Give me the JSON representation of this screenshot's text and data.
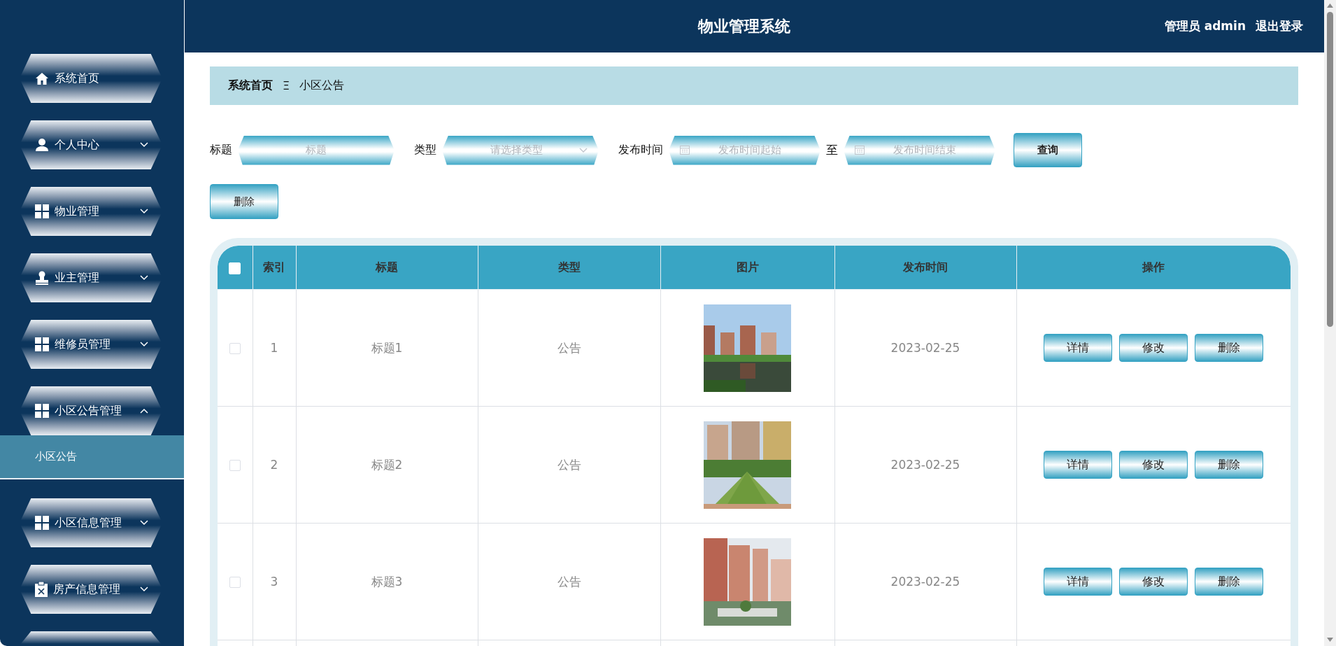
{
  "header": {
    "title": "物业管理系统",
    "user": "管理员 admin",
    "logout": "退出登录"
  },
  "sidebar": {
    "items": [
      {
        "label": "系统首页",
        "kind": "link"
      },
      {
        "label": "个人中心",
        "kind": "menu",
        "expanded": false
      },
      {
        "label": "物业管理",
        "kind": "menu",
        "expanded": false
      },
      {
        "label": "业主管理",
        "kind": "menu",
        "expanded": false
      },
      {
        "label": "维修员管理",
        "kind": "menu",
        "expanded": false
      },
      {
        "label": "小区公告管理",
        "kind": "menu",
        "expanded": true,
        "children": [
          {
            "label": "小区公告",
            "selected": true
          }
        ]
      },
      {
        "label": "小区信息管理",
        "kind": "menu",
        "expanded": false
      },
      {
        "label": "房产信息管理",
        "kind": "menu",
        "expanded": false
      }
    ]
  },
  "breadcrumb": {
    "items": [
      "系统首页",
      "小区公告"
    ],
    "separator": "Ξ"
  },
  "filters": [
    {
      "kind": "text",
      "label": "标题",
      "placeholder": "标题"
    },
    {
      "kind": "select",
      "label": "类型",
      "placeholder": "请选择类型"
    },
    {
      "kind": "daterange",
      "label": "发布时间",
      "placeholder": "发布时间起始",
      "to": "至",
      "placeholder_end": "发布时间结束"
    }
  ],
  "search_button": "查询",
  "delete_button": "删除",
  "table": {
    "select_all": {
      "checked": false
    },
    "columns": [
      "索引",
      "标题",
      "类型",
      "图片",
      "发布时间",
      "操作"
    ],
    "rows": [
      {
        "checked": false,
        "index": "1",
        "title": "标题1",
        "type": "公告",
        "date": "2023-02-25",
        "actions": [
          "详情",
          "修改",
          "删除"
        ]
      },
      {
        "checked": false,
        "index": "2",
        "title": "标题2",
        "type": "公告",
        "date": "2023-02-25",
        "actions": [
          "详情",
          "修改",
          "删除"
        ]
      },
      {
        "checked": false,
        "index": "3",
        "title": "标题3",
        "type": "公告",
        "date": "2023-02-25",
        "actions": [
          "详情",
          "修改",
          "删除"
        ]
      }
    ]
  }
}
